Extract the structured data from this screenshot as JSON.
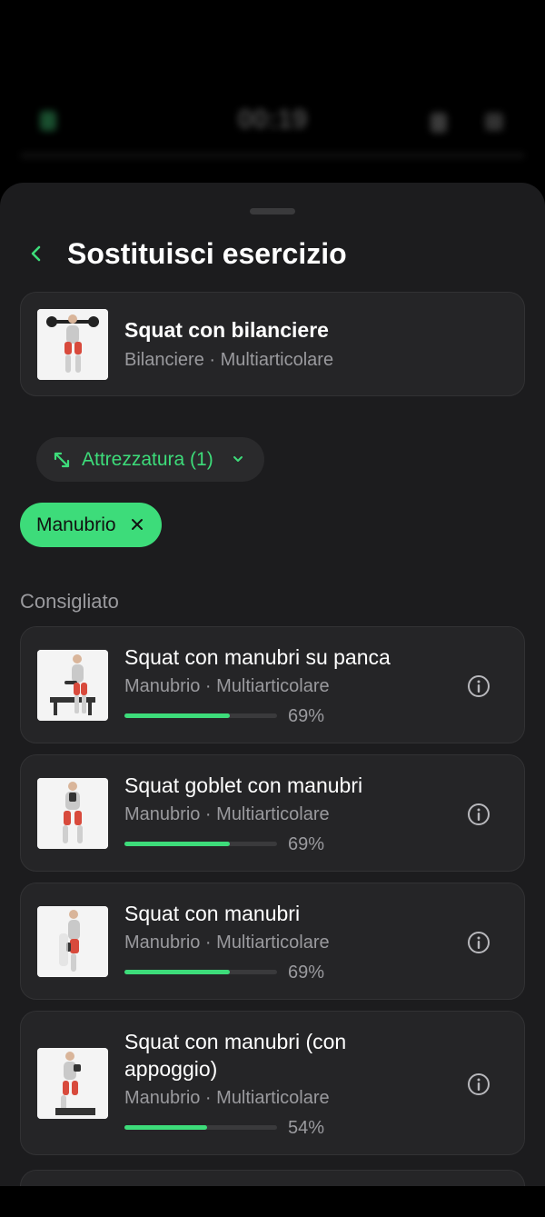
{
  "background": {
    "timer": "00:19"
  },
  "header": {
    "title": "Sostituisci esercizio"
  },
  "current": {
    "name": "Squat con bilanciere",
    "subtitle": "Bilanciere · Multiarticolare"
  },
  "filter": {
    "label": "Attrezzatura (1)"
  },
  "chip": {
    "label": "Manubrio"
  },
  "section": {
    "title": "Consigliato"
  },
  "recommended": [
    {
      "name": "Squat con manubri su panca",
      "subtitle": "Manubrio · Multiarticolare",
      "match": 0.69,
      "match_label": "69%"
    },
    {
      "name": "Squat goblet con manubri",
      "subtitle": "Manubrio · Multiarticolare",
      "match": 0.69,
      "match_label": "69%"
    },
    {
      "name": "Squat con manubri",
      "subtitle": "Manubrio · Multiarticolare",
      "match": 0.69,
      "match_label": "69%"
    },
    {
      "name": "Squat con manubri (con appoggio)",
      "subtitle": "Manubrio · Multiarticolare",
      "match": 0.54,
      "match_label": "54%"
    }
  ],
  "colors": {
    "accent": "#3ddc7a",
    "sheet": "#1c1c1e",
    "card": "#252527"
  },
  "icons": {
    "back": "chevron-left-icon",
    "filter": "expand-arrows-icon",
    "dropdown": "chevron-down-icon",
    "remove": "close-icon",
    "info": "info-icon"
  }
}
